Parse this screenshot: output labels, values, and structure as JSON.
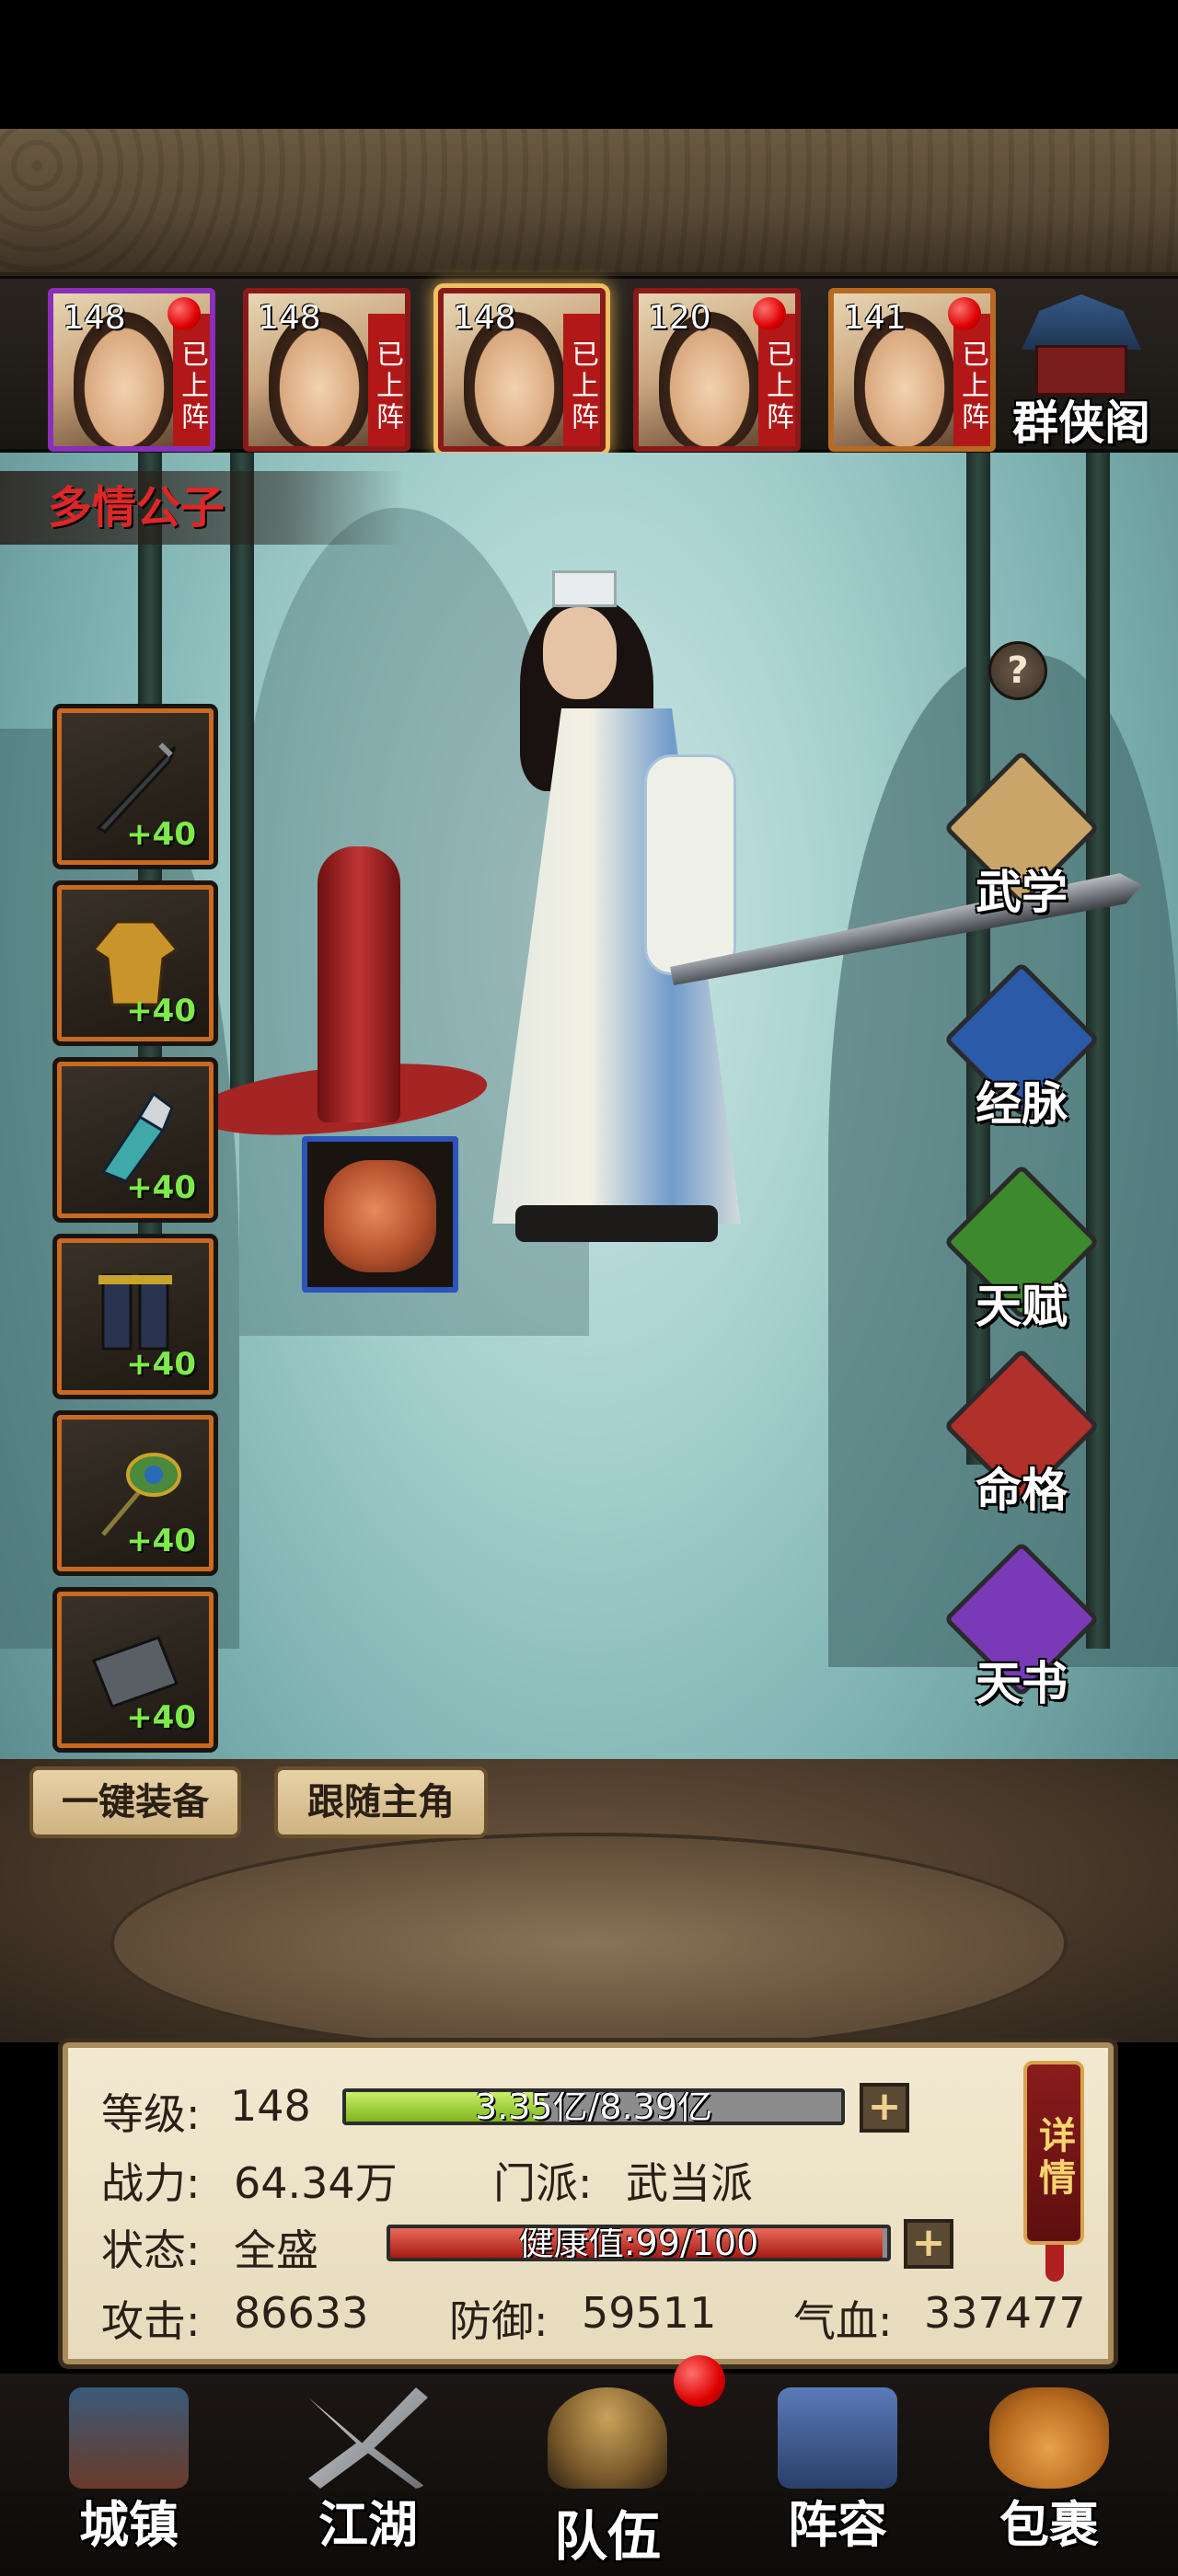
{
  "character": {
    "name": "多情公子"
  },
  "heroes": [
    {
      "level": "148",
      "tag": "已上阵",
      "frame": "purple",
      "has_alert": true,
      "selected": false
    },
    {
      "level": "148",
      "tag": "已上阵",
      "frame": "red",
      "has_alert": false,
      "selected": false
    },
    {
      "level": "148",
      "tag": "已上阵",
      "frame": "red",
      "has_alert": false,
      "selected": true
    },
    {
      "level": "120",
      "tag": "已上阵",
      "frame": "red",
      "has_alert": true,
      "selected": false
    },
    {
      "level": "141",
      "tag": "已上阵",
      "frame": "orange",
      "has_alert": true,
      "selected": false
    }
  ],
  "hero_hall": {
    "label": "群侠阁",
    "icon": "pavilion-icon"
  },
  "equipment": [
    {
      "slot": "weapon",
      "icon": "sword-icon",
      "bonus": "+40"
    },
    {
      "slot": "armor",
      "icon": "robe-icon",
      "bonus": "+40"
    },
    {
      "slot": "bracer",
      "icon": "bracer-icon",
      "bonus": "+40"
    },
    {
      "slot": "boots",
      "icon": "boots-icon",
      "bonus": "+40"
    },
    {
      "slot": "accessory",
      "icon": "peacock-feather-icon",
      "bonus": "+40"
    },
    {
      "slot": "token",
      "icon": "scroll-token-icon",
      "bonus": "+40"
    }
  ],
  "pet": {
    "icon": "snake-icon"
  },
  "buttons": {
    "equip_all": "一键装备",
    "follow": "跟随主角"
  },
  "side_menu": [
    {
      "label": "武学",
      "icon": "martial-arts-scroll-icon",
      "color": "#c9a56a"
    },
    {
      "label": "经脉",
      "icon": "meridian-icon",
      "color": "#2a5aa8"
    },
    {
      "label": "天赋",
      "icon": "talent-icon",
      "color": "#3d8a2e"
    },
    {
      "label": "命格",
      "icon": "fate-icon",
      "color": "#b0302a"
    },
    {
      "label": "天书",
      "icon": "heaven-book-icon",
      "color": "#7a3ab8"
    }
  ],
  "help": {
    "label": "?"
  },
  "stats": {
    "level_label": "等级:",
    "level_value": "148",
    "exp_text": "3.35亿/8.39亿",
    "exp_fraction": 0.4,
    "power_label": "战力:",
    "power_value": "64.34万",
    "sect_label": "门派:",
    "sect_value": "武当派",
    "status_label": "状态:",
    "status_value": "全盛",
    "health_text": "健康值:99/100",
    "health_fraction": 0.99,
    "attack_label": "攻击:",
    "attack_value": "86633",
    "defense_label": "防御:",
    "defense_value": "59511",
    "hp_label": "气血:",
    "hp_value": "337477",
    "plus": "+",
    "detail": "详情"
  },
  "bottom_nav": [
    {
      "label": "城镇",
      "icon": "town-icon",
      "active": false
    },
    {
      "label": "江湖",
      "icon": "crossed-swords-icon",
      "active": false
    },
    {
      "label": "队伍",
      "icon": "team-icon",
      "active": true
    },
    {
      "label": "阵容",
      "icon": "formation-icon",
      "active": false
    },
    {
      "label": "包裹",
      "icon": "bag-icon",
      "active": false
    }
  ]
}
